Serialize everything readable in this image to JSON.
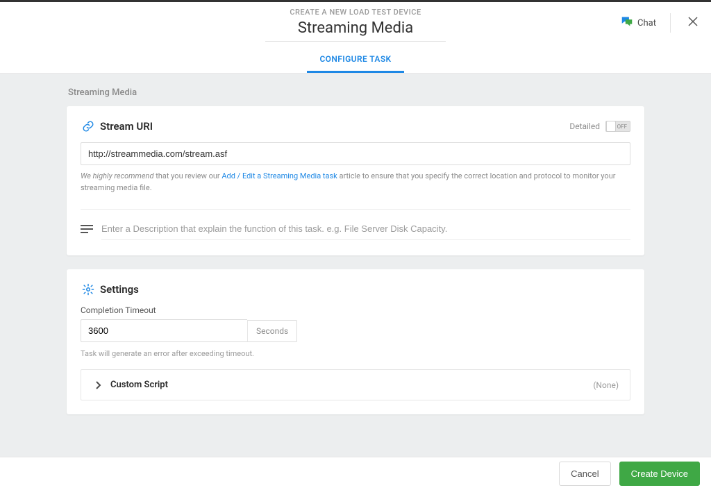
{
  "header": {
    "caption": "CREATE A NEW LOAD TEST DEVICE",
    "title": "Streaming Media",
    "tab_label": "CONFIGURE TASK",
    "chat_label": "Chat"
  },
  "crumb": "Streaming Media",
  "stream": {
    "section_title": "Stream URI",
    "detailed_label": "Detailed",
    "toggle_state": "OFF",
    "uri_value": "http://streammedia.com/stream.asf",
    "help_prefix_italic": "We highly recommend",
    "help_mid": " that you review our ",
    "help_link": "Add / Edit a Streaming Media task",
    "help_suffix": " article to ensure that you specify the correct location and protocol to monitor your streaming media file.",
    "description_placeholder": "Enter a Description that explain the function of this task. e.g. File Server Disk Capacity."
  },
  "settings": {
    "section_title": "Settings",
    "timeout_label": "Completion Timeout",
    "timeout_value": "3600",
    "timeout_unit": "Seconds",
    "timeout_hint": "Task will generate an error after exceeding timeout.",
    "custom_script_title": "Custom Script",
    "custom_script_status": "(None)"
  },
  "footer": {
    "cancel": "Cancel",
    "create": "Create Device"
  }
}
